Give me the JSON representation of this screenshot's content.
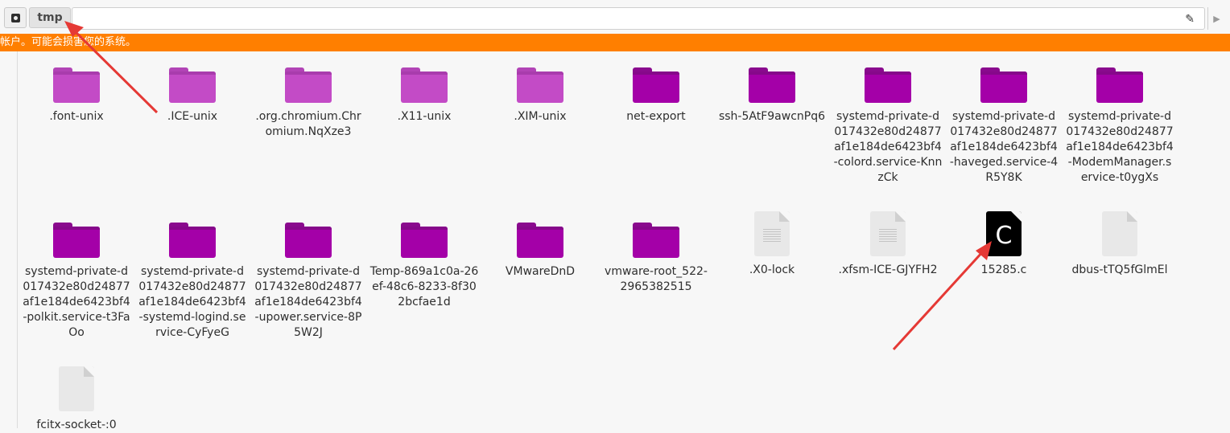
{
  "pathbar": {
    "current_folder": "tmp",
    "edit_icon": "pencil-icon",
    "drive_icon": "drive-icon",
    "next_icon": "chevron-right-icon"
  },
  "warning": {
    "text": "帐户。可能会损害您的系统。",
    "color": "#ff7f00"
  },
  "items": [
    {
      "name": ".font-unix",
      "type": "folder-light"
    },
    {
      "name": ".ICE-unix",
      "type": "folder-light"
    },
    {
      "name": ".org.chromium.Chromium.NqXze3",
      "type": "folder-light"
    },
    {
      "name": ".X11-unix",
      "type": "folder-light"
    },
    {
      "name": ".XIM-unix",
      "type": "folder-light"
    },
    {
      "name": "net-export",
      "type": "folder-dark"
    },
    {
      "name": "ssh-5AtF9awcnPq6",
      "type": "folder-dark"
    },
    {
      "name": "systemd-private-d017432e80d24877af1e184de6423bf4-colord.service-KnnzCk",
      "type": "folder-dark"
    },
    {
      "name": "systemd-private-d017432e80d24877af1e184de6423bf4-haveged.service-4R5Y8K",
      "type": "folder-dark"
    },
    {
      "name": "systemd-private-d017432e80d24877af1e184de6423bf4-ModemManager.service-t0ygXs",
      "type": "folder-dark"
    },
    {
      "name": "systemd-private-d017432e80d24877af1e184de6423bf4-polkit.service-t3FaOo",
      "type": "folder-dark"
    },
    {
      "name": "systemd-private-d017432e80d24877af1e184de6423bf4-systemd-logind.service-CyFyeG",
      "type": "folder-dark"
    },
    {
      "name": "systemd-private-d017432e80d24877af1e184de6423bf4-upower.service-8P5W2J",
      "type": "folder-dark"
    },
    {
      "name": "Temp-869a1c0a-26ef-48c6-8233-8f302bcfae1d",
      "type": "folder-dark"
    },
    {
      "name": "VMwareDnD",
      "type": "folder-dark"
    },
    {
      "name": "vmware-root_522-2965382515",
      "type": "folder-dark"
    },
    {
      "name": ".X0-lock",
      "type": "text-file"
    },
    {
      "name": ".xfsm-ICE-GJYFH2",
      "type": "text-file"
    },
    {
      "name": "15285.c",
      "type": "c-source-file",
      "glyph": "C"
    },
    {
      "name": "dbus-tTQ5fGlmEl",
      "type": "blank-file"
    },
    {
      "name": "fcitx-socket-:0",
      "type": "blank-file"
    }
  ],
  "annotation_color": "#e53935"
}
